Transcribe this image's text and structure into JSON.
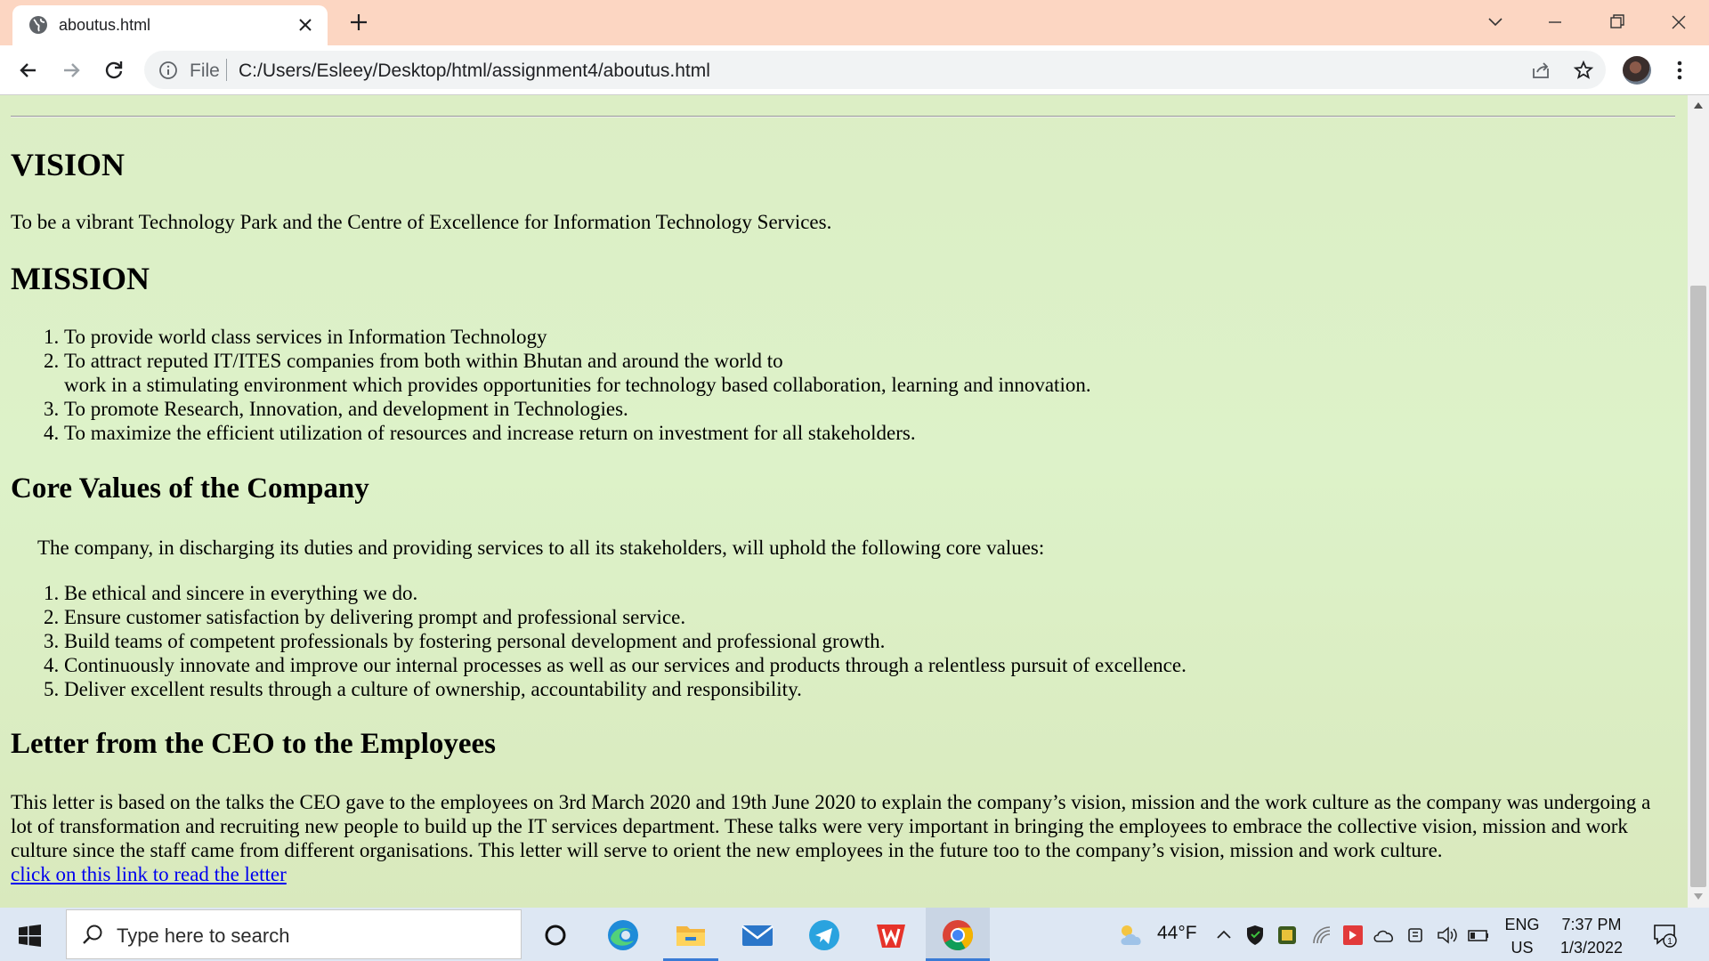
{
  "browser": {
    "tab_title": "aboutus.html",
    "omnibox_scheme": "File",
    "url": "C:/Users/Esleey/Desktop/html/assignment4/aboutus.html"
  },
  "content": {
    "vision_heading": "VISION",
    "vision_text": "To be a vibrant Technology Park and the Centre of Excellence for Information Technology Services.",
    "mission_heading": "MISSION",
    "mission_items": [
      "To provide world class services in Information Technology",
      "To attract reputed IT/ITES companies from both within Bhutan and around the world to",
      "work in a stimulating environment which provides opportunities for technology based collaboration, learning and innovation.",
      "To promote Research, Innovation, and development in Technologies.",
      "To maximize the efficient utilization of resources and increase return on investment for all stakeholders."
    ],
    "core_heading": "Core Values of the Company",
    "core_intro": "The company, in discharging its duties and providing services to all its stakeholders, will uphold the following core values:",
    "core_items": [
      "Be ethical and sincere in everything we do.",
      "Ensure customer satisfaction by delivering prompt and professional service.",
      "Build teams of competent professionals by fostering personal development and professional growth.",
      "Continuously innovate and improve our internal processes as well as our services and products through a relentless pursuit of excellence.",
      "Deliver excellent results through a culture of ownership, accountability and responsibility."
    ],
    "letter_heading": "Letter from the CEO to the Employees",
    "letter_text": "This letter is based on the talks the CEO gave to the employees on 3rd March 2020 and 19th June 2020 to explain the company’s vision, mission and the work culture as the company was undergoing a lot of transformation and recruiting new people to build up the IT services department. These talks were very important in bringing the employees to embrace the collective vision, mission and work culture since the staff came from different organisations. This letter will serve to orient the new employees in the future too to the company’s vision, mission and work culture.",
    "letter_link": "click on this link to read the letter"
  },
  "taskbar": {
    "search_placeholder": "Type here to search",
    "weather": "44°F",
    "lang_line1": "ENG",
    "lang_line2": "US",
    "time": "7:37 PM",
    "date": "1/3/2022",
    "notification_count": "1"
  },
  "colors": {
    "tabstrip": "#fcd6c2",
    "page_bg": "#dceec5",
    "link": "#0000ee",
    "taskbar": "#dde7f3"
  },
  "icons": [
    "globe-icon",
    "close-icon",
    "plus-icon",
    "chevron-down-icon",
    "minimize-icon",
    "restore-icon",
    "close-window-icon",
    "back-icon",
    "forward-icon",
    "reload-icon",
    "info-icon",
    "share-icon",
    "star-icon",
    "avatar",
    "more-icon",
    "windows-icon",
    "search-icon",
    "cortana-icon",
    "edge-icon",
    "file-explorer-icon",
    "mail-icon",
    "telegram-icon",
    "wps-icon",
    "chrome-icon",
    "weather-icon",
    "notification-icon"
  ]
}
